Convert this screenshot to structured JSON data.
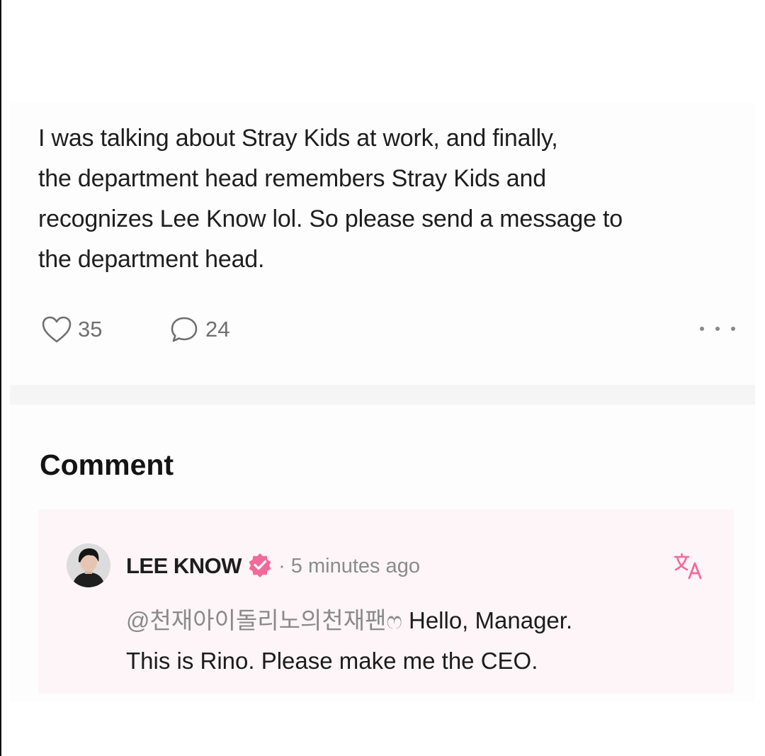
{
  "post": {
    "text": "I was talking about Stray Kids at work, and finally,\nthe department head remembers Stray Kids and\nrecognizes Lee Know lol. So please send a message to\nthe department head.",
    "likes": "35",
    "comments": "24",
    "like_icon": "heart-outline",
    "comment_icon": "speech-bubble-outline",
    "more_icon": "three-dots-horizontal"
  },
  "comments_section": {
    "title": "Comment",
    "items": [
      {
        "author": "LEE KNOW",
        "verified_icon": "pink-verified-badge",
        "time": "· 5 minutes ago",
        "mention": "@천재아이돌리노의천재팬ෆ",
        "text_line1": " Hello, Manager.",
        "text_line2": "This is Rino. Please make me the CEO.",
        "translate_icon": "translate"
      }
    ]
  },
  "colors": {
    "accent_pink": "#f26a9a",
    "comment_background": "#fdf5f7",
    "muted_text": "#8b8b8b"
  }
}
